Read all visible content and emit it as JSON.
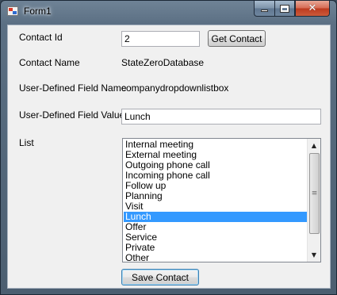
{
  "window": {
    "title": "Form1",
    "icons": {
      "app": "form-app-icon",
      "minimize": "minimize-icon",
      "maximize": "maximize-icon",
      "close": "close-icon"
    },
    "minimize_glyph": "",
    "close_glyph": "✕"
  },
  "form": {
    "contact_id_label": "Contact Id",
    "contact_id_value": "2",
    "get_contact_label": "Get Contact",
    "contact_name_label": "Contact Name",
    "contact_name_value": "StateZeroDatabase",
    "udf_name_label": "User-Defined Field Name",
    "udf_name_value": "companydropdownlistbox",
    "udf_value_label": "User-Defined Field Value",
    "udf_value_value": "Lunch",
    "list_label": "List",
    "list_items": [
      "Internal meeting",
      "External meeting",
      "Outgoing phone call",
      "Incoming phone call",
      "Follow up",
      "Planning",
      "Visit",
      "Lunch",
      "Offer",
      "Service",
      "Private",
      "Other"
    ],
    "list_selected": "Lunch",
    "scroll_up_glyph": "▲",
    "scroll_down_glyph": "▼",
    "scroll_thumb_glyph": "≡",
    "save_contact_label": "Save Contact"
  },
  "colors": {
    "selection": "#3399ff",
    "close_button": "#c9452a",
    "window_frame": "#5b6f83"
  }
}
